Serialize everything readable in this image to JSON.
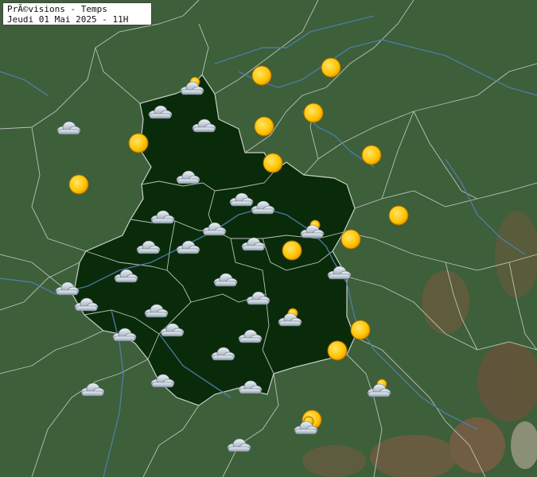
{
  "legend": {
    "title": "PrÃ©visions - Temps",
    "subtitle": "Jeudi 01 Mai 2025 - 11H"
  },
  "colors": {
    "land": "#3d5f3a",
    "region": "#0a2b0a",
    "border": "#b9c2b9",
    "river": "#4f7fb0",
    "relief": "#8a5a44",
    "sun": "#ffc400",
    "cloud": "#b9c6d2"
  },
  "weather_icons": [
    {
      "kind": "sun"
    },
    {
      "kind": "sun"
    },
    {
      "kind": "sun"
    },
    {
      "kind": "sun"
    },
    {
      "kind": "sun"
    },
    {
      "kind": "sun"
    },
    {
      "kind": "sun"
    },
    {
      "kind": "sun"
    },
    {
      "kind": "sun"
    },
    {
      "kind": "sun"
    },
    {
      "kind": "sun"
    },
    {
      "kind": "sun"
    },
    {
      "kind": "sun"
    },
    {
      "kind": "sun"
    },
    {
      "kind": "sun-cloud"
    },
    {
      "kind": "sun-cloud"
    },
    {
      "kind": "sun-cloud"
    },
    {
      "kind": "sun-cloud"
    },
    {
      "kind": "sun-cloud"
    },
    {
      "kind": "cloud"
    },
    {
      "kind": "cloud"
    },
    {
      "kind": "cloud"
    },
    {
      "kind": "cloud"
    },
    {
      "kind": "cloud"
    },
    {
      "kind": "cloud"
    },
    {
      "kind": "cloud"
    },
    {
      "kind": "cloud"
    },
    {
      "kind": "cloud"
    },
    {
      "kind": "cloud"
    },
    {
      "kind": "cloud"
    },
    {
      "kind": "cloud"
    },
    {
      "kind": "cloud"
    },
    {
      "kind": "cloud"
    },
    {
      "kind": "cloud"
    },
    {
      "kind": "cloud"
    },
    {
      "kind": "cloud"
    },
    {
      "kind": "cloud"
    },
    {
      "kind": "cloud"
    },
    {
      "kind": "cloud"
    },
    {
      "kind": "cloud"
    },
    {
      "kind": "cloud"
    },
    {
      "kind": "cloud"
    },
    {
      "kind": "cloud"
    },
    {
      "kind": "cloud"
    },
    {
      "kind": "cloud"
    },
    {
      "kind": "cloud"
    }
  ]
}
